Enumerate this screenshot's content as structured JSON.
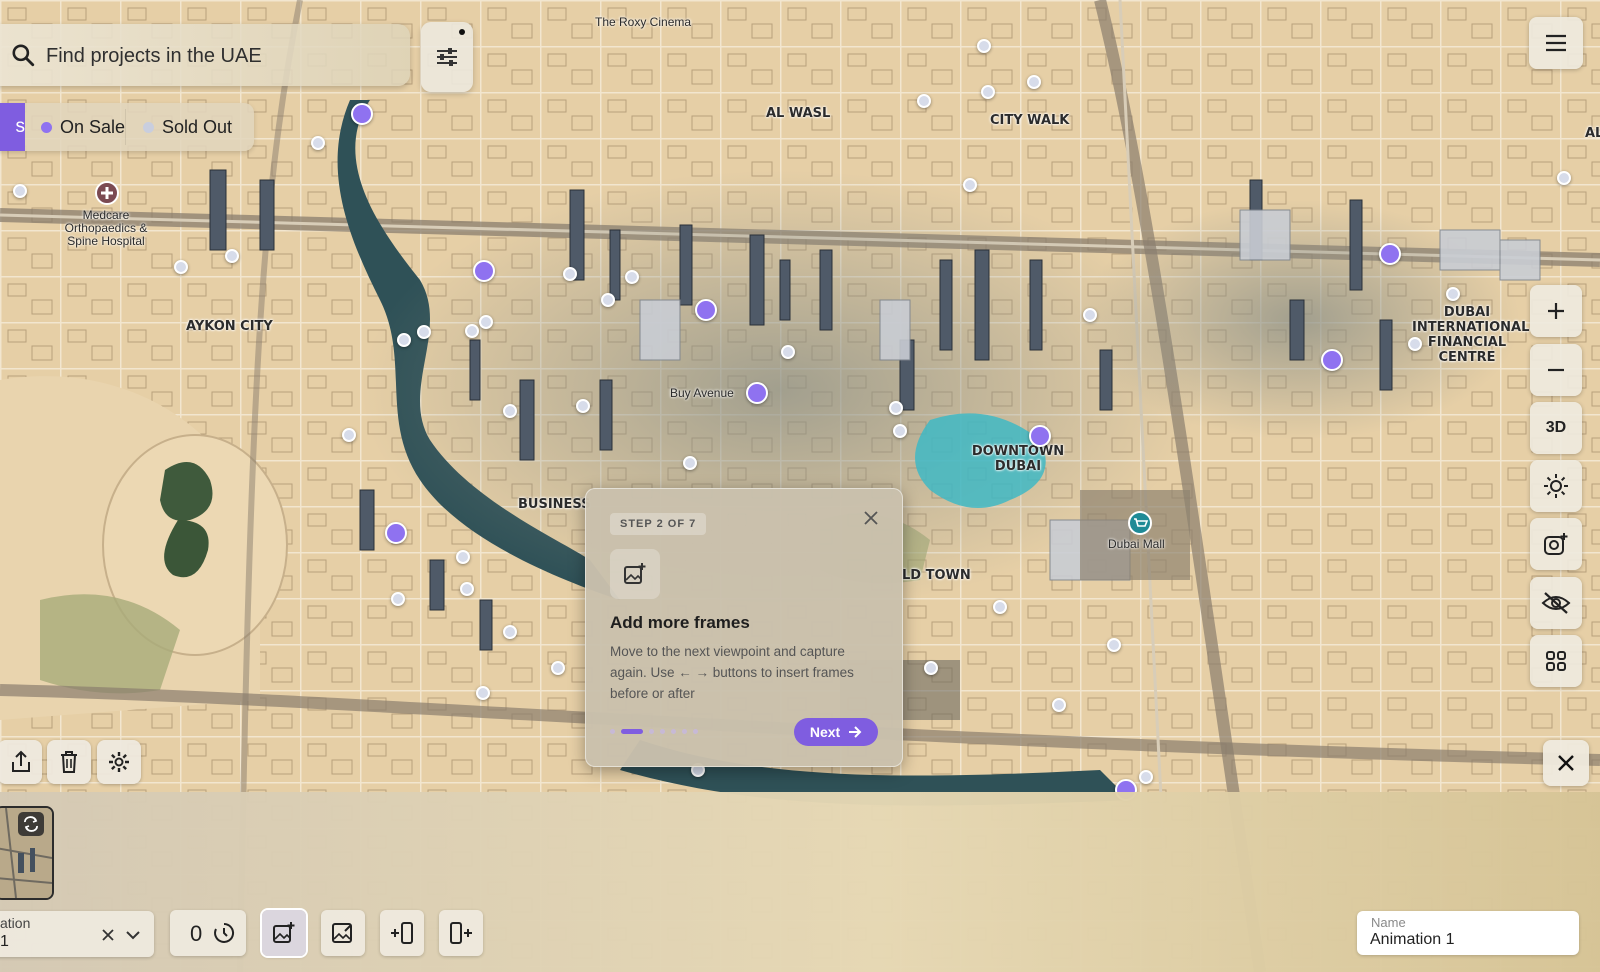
{
  "search": {
    "placeholder": "Find projects in the UAE",
    "search_icon": "search-icon",
    "filter_icon": "sliders-icon"
  },
  "legend": {
    "active_label": "s",
    "items": [
      {
        "label": "On Sale",
        "color": "#8f72f0"
      },
      {
        "label": "Sold Out",
        "color": "#c9cede"
      }
    ]
  },
  "map": {
    "area_labels": [
      "AL WASL",
      "CITY WALK",
      "AYKON CITY",
      "DUBAI INTERNATIONAL FINANCIAL CENTRE",
      "DOWNTOWN DUBAI",
      "BUSINESS",
      "LD TOWN",
      "AL"
    ],
    "poi_labels": [
      "The Roxy Cinema",
      "Medcare Orthopaedics & Spine Hospital",
      "Buy Avenue",
      "Dubai Mall"
    ],
    "marker_colors": {
      "on_sale": "#8f72f0",
      "sold_out": "#d7dcea"
    }
  },
  "right_toolbar": {
    "menu_icon": "hamburger-menu-icon",
    "zoom_in_icon": "plus-icon",
    "zoom_out_icon": "minus-icon",
    "view_mode_label": "3D",
    "light_icon": "sun-icon",
    "capture_icon": "camera-plus-icon",
    "hide_icon": "eye-off-icon",
    "grid_icon": "grid-icon",
    "close_icon": "close-icon"
  },
  "dialog": {
    "step": "STEP 2 OF 7",
    "title": "Add more frames",
    "body": "Move to the next viewpoint and capture again. Use ← → buttons to insert frames before or after",
    "next_label": "Next",
    "total_steps": 7,
    "current_step": 2
  },
  "bottom_panel": {
    "animation_label": "ation",
    "animation_value": "1",
    "frame_duration": "0",
    "name_label": "Name",
    "name_value": "Animation 1"
  },
  "colors": {
    "accent": "#7f5de0"
  }
}
